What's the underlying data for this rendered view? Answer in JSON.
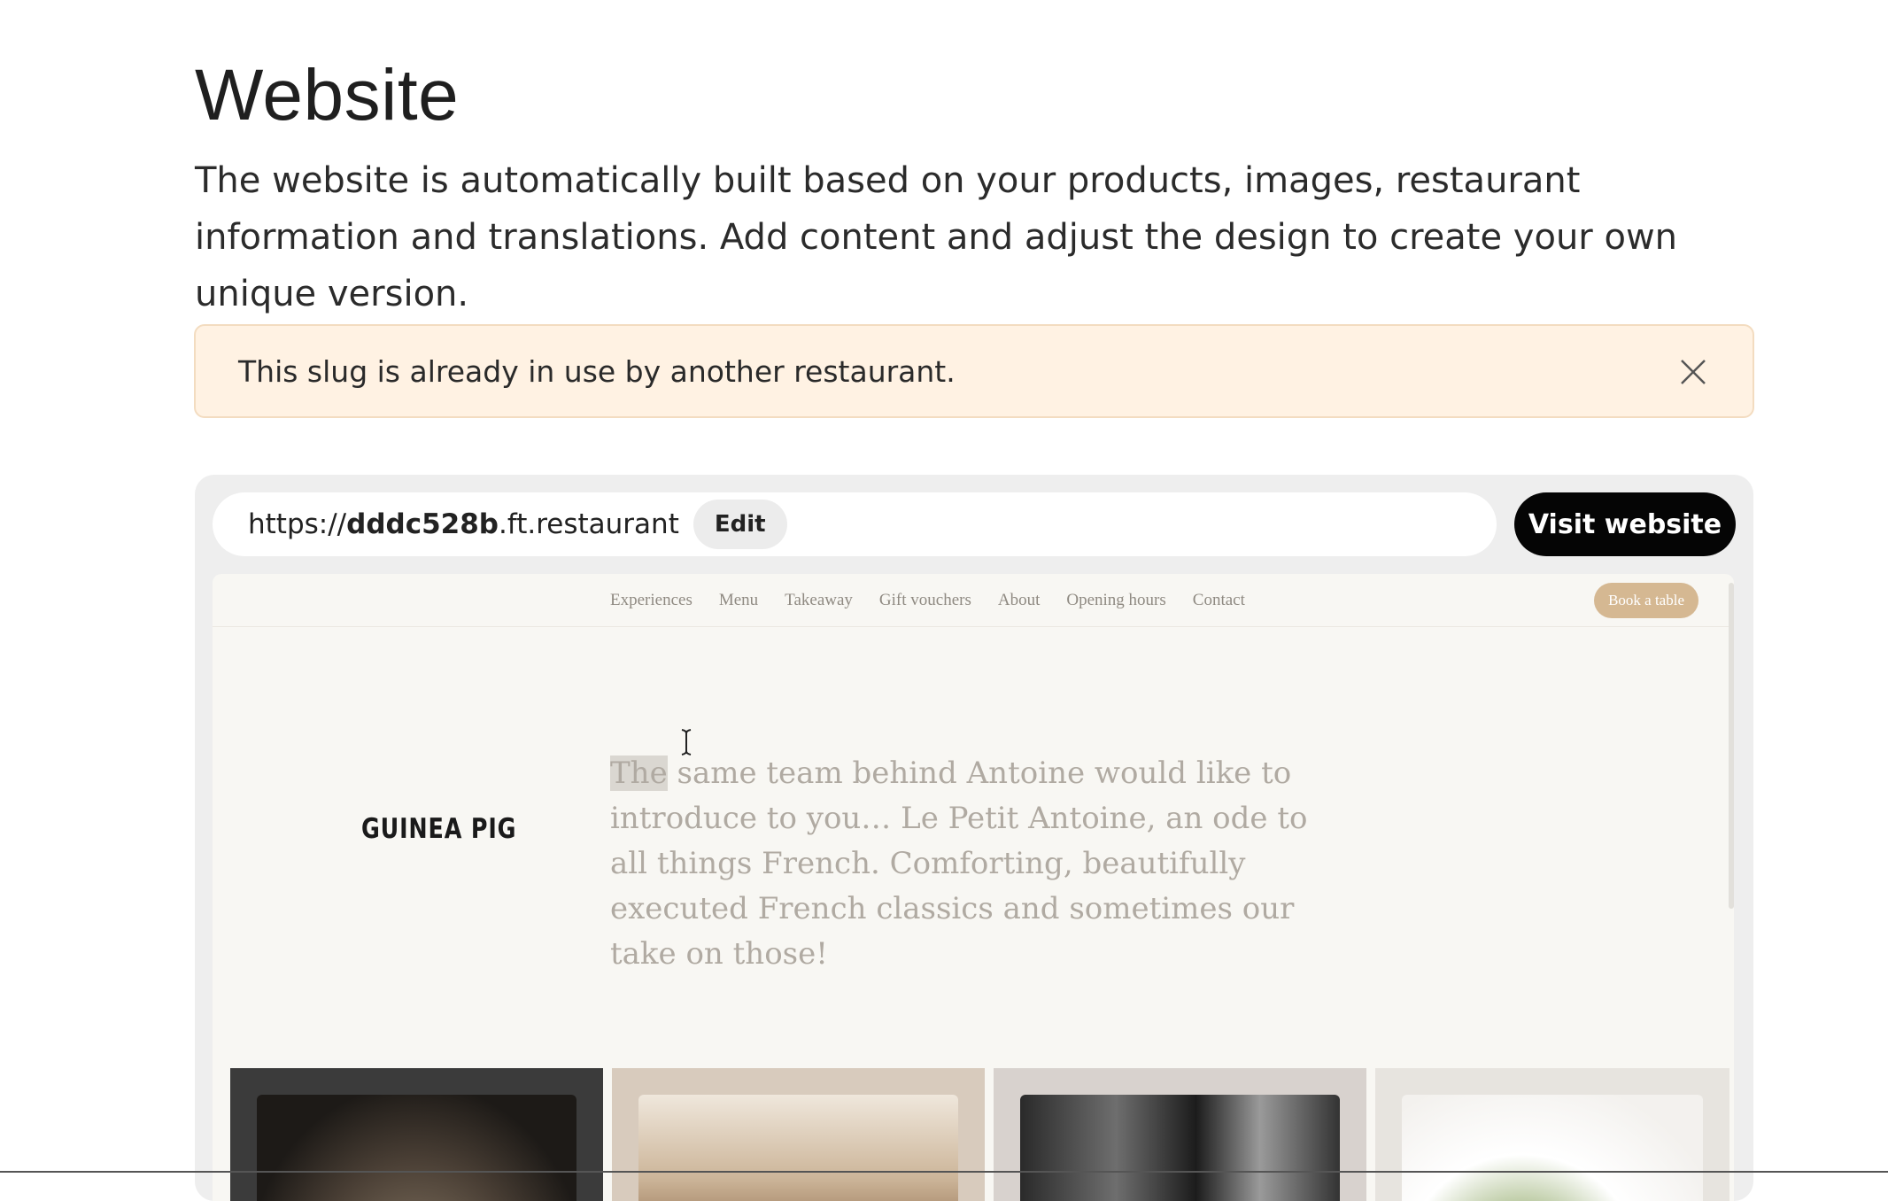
{
  "header": {
    "title": "Website",
    "description": "The website is automatically built based on your products, images, restaurant information and translations. Add content and adjust the design to create your own unique version."
  },
  "alert": {
    "message": "This slug is already in use by another restaurant.",
    "close_icon": "close-icon"
  },
  "url_bar": {
    "prefix": "https://",
    "slug": "dddc528b",
    "suffix": ".ft.restaurant",
    "edit_label": "Edit",
    "visit_label": "Visit website"
  },
  "preview": {
    "nav": [
      "Experiences",
      "Menu",
      "Takeaway",
      "Gift vouchers",
      "About",
      "Opening hours",
      "Contact"
    ],
    "book_label": "Book a table",
    "logo": "GUINEA PIG",
    "intro_highlight": "The",
    "intro_rest": " same team behind Antoine would like to introduce to you… Le Petit Antoine, an ode to all things French. Comforting, beautifully executed French classics and sometimes our take on those!",
    "gallery": [
      "dark-plate-photo",
      "restaurant-interior-photo",
      "street-photo",
      "food-dish-photo"
    ]
  },
  "colors": {
    "alert_bg": "#fff2e3",
    "visit_button": "#050505",
    "book_button": "#d5b892",
    "preview_bg": "#f8f7f3"
  }
}
